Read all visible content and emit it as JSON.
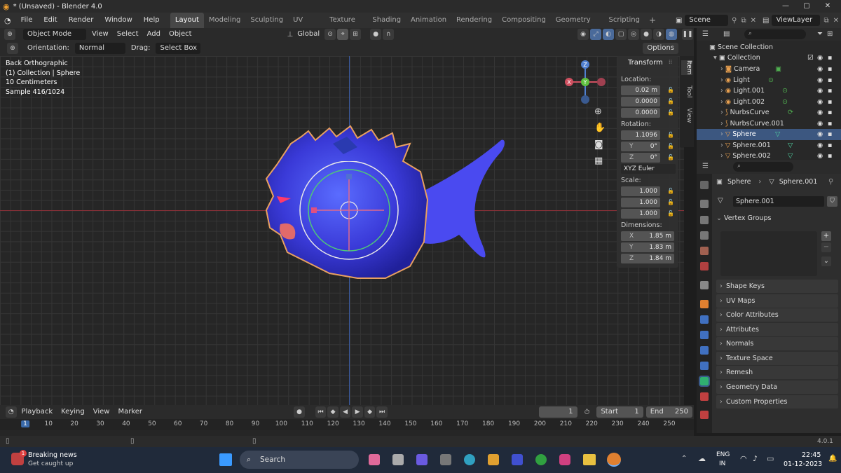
{
  "window": {
    "title": "* (Unsaved) - Blender 4.0"
  },
  "menus": [
    "File",
    "Edit",
    "Render",
    "Window",
    "Help"
  ],
  "workspaces": [
    "Layout",
    "Modeling",
    "Sculpting",
    "UV Editing",
    "Texture Paint",
    "Shading",
    "Animation",
    "Rendering",
    "Compositing",
    "Geometry Nodes",
    "Scripting"
  ],
  "scene": {
    "label": "Scene",
    "view_layer": "ViewLayer"
  },
  "viewport_header": {
    "mode": "Object Mode",
    "menus": [
      "View",
      "Select",
      "Add",
      "Object"
    ],
    "transform_orientation": "Global"
  },
  "tool_settings": {
    "orientation_label": "Orientation:",
    "orientation_value": "Normal",
    "drag_label": "Drag:",
    "drag_value": "Select Box",
    "options_label": "Options"
  },
  "overlay_info": {
    "view": "Back Orthographic",
    "collection": "(1) Collection | Sphere",
    "scale": "10 Centimeters",
    "sample": "Sample 416/1024"
  },
  "gizmo_axes": {
    "z": "Z",
    "y": "Y",
    "x": "X"
  },
  "n_panel": {
    "title": "Transform",
    "location_label": "Location:",
    "location": [
      "0.02 m",
      "0.0000",
      "0.0000"
    ],
    "rotation_label": "Rotation:",
    "rotation": [
      "1.1096",
      "0°",
      "0°"
    ],
    "rotation_axes": [
      "",
      "Y",
      "Z"
    ],
    "rotation_mode": "XYZ Euler",
    "scale_label": "Scale:",
    "scale": [
      "1.000",
      "1.000",
      "1.000"
    ],
    "dimensions_label": "Dimensions:",
    "dimensions": [
      "1.85 m",
      "1.83 m",
      "1.84 m"
    ],
    "dimension_axes": [
      "X",
      "Y",
      "Z"
    ],
    "tabs": [
      "Item",
      "Tool",
      "View"
    ]
  },
  "outliner": {
    "root": "Scene Collection",
    "collection": "Collection",
    "items": [
      "Camera",
      "Light",
      "Light.001",
      "Light.002",
      "NurbsCurve",
      "NurbsCurve.001",
      "Sphere",
      "Sphere.001",
      "Sphere.002"
    ],
    "selected_index": 6
  },
  "properties": {
    "breadcrumb_object": "Sphere",
    "breadcrumb_data": "Sphere.001",
    "mesh_name": "Sphere.001",
    "sections": [
      "Vertex Groups",
      "Shape Keys",
      "UV Maps",
      "Color Attributes",
      "Attributes",
      "Normals",
      "Texture Space",
      "Remesh",
      "Geometry Data",
      "Custom Properties"
    ]
  },
  "timeline": {
    "menus": [
      "Playback",
      "Keying",
      "View",
      "Marker"
    ],
    "current_frame": "1",
    "start_label": "Start",
    "start": "1",
    "end_label": "End",
    "end": "250",
    "ticks": [
      "1",
      "10",
      "20",
      "30",
      "40",
      "50",
      "60",
      "70",
      "80",
      "90",
      "100",
      "110",
      "120",
      "130",
      "140",
      "150",
      "160",
      "170",
      "180",
      "190",
      "200",
      "210",
      "220",
      "230",
      "240",
      "250"
    ]
  },
  "status": {
    "version": "4.0.1"
  },
  "taskbar": {
    "news_title": "Breaking news",
    "news_sub": "Get caught up",
    "news_badge": "1",
    "search": "Search",
    "lang": "ENG",
    "region": "IN",
    "time": "22:45",
    "date": "01-12-2023"
  }
}
